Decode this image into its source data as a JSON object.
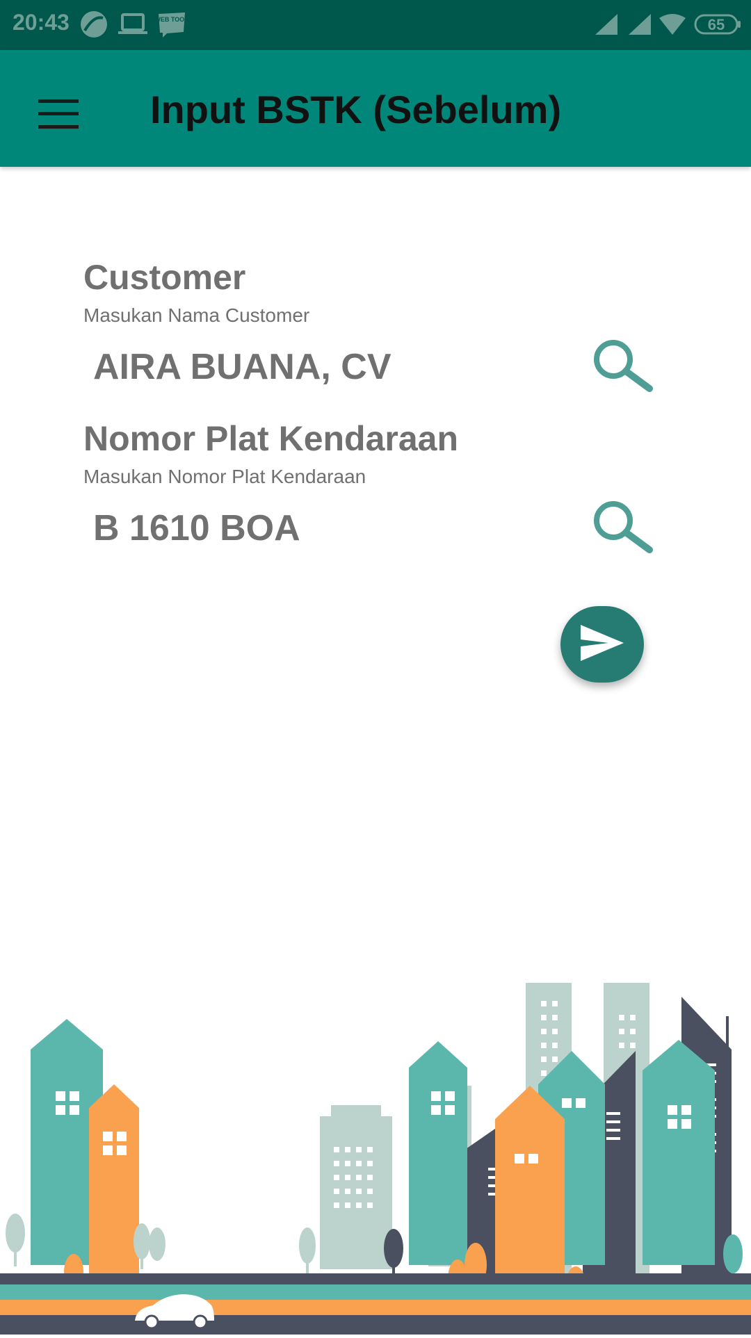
{
  "status_bar": {
    "time": "20:43",
    "battery": "65",
    "icons": [
      "app-notification-icon",
      "laptop-icon",
      "webtoon-icon",
      "signal-icon",
      "signal-icon",
      "wifi-icon",
      "battery-icon"
    ],
    "webtoon_text": "WEB TOON"
  },
  "app_bar": {
    "title": "Input BSTK (Sebelum)",
    "menu_icon": "hamburger-menu-icon",
    "color": "#00877a"
  },
  "form": {
    "customer": {
      "label": "Customer",
      "hint": "Masukan Nama Customer",
      "value": "AIRA BUANA, CV",
      "search_icon": "search-icon"
    },
    "plate": {
      "label": "Nomor Plat Kendaraan",
      "hint": "Masukan Nomor Plat Kendaraan",
      "value": "B 1610 BOA",
      "search_icon": "search-icon"
    },
    "submit_icon": "send-icon"
  },
  "colors": {
    "status_bar": "#00574b",
    "accent": "#267c73",
    "search_icon": "#4e9e96"
  }
}
